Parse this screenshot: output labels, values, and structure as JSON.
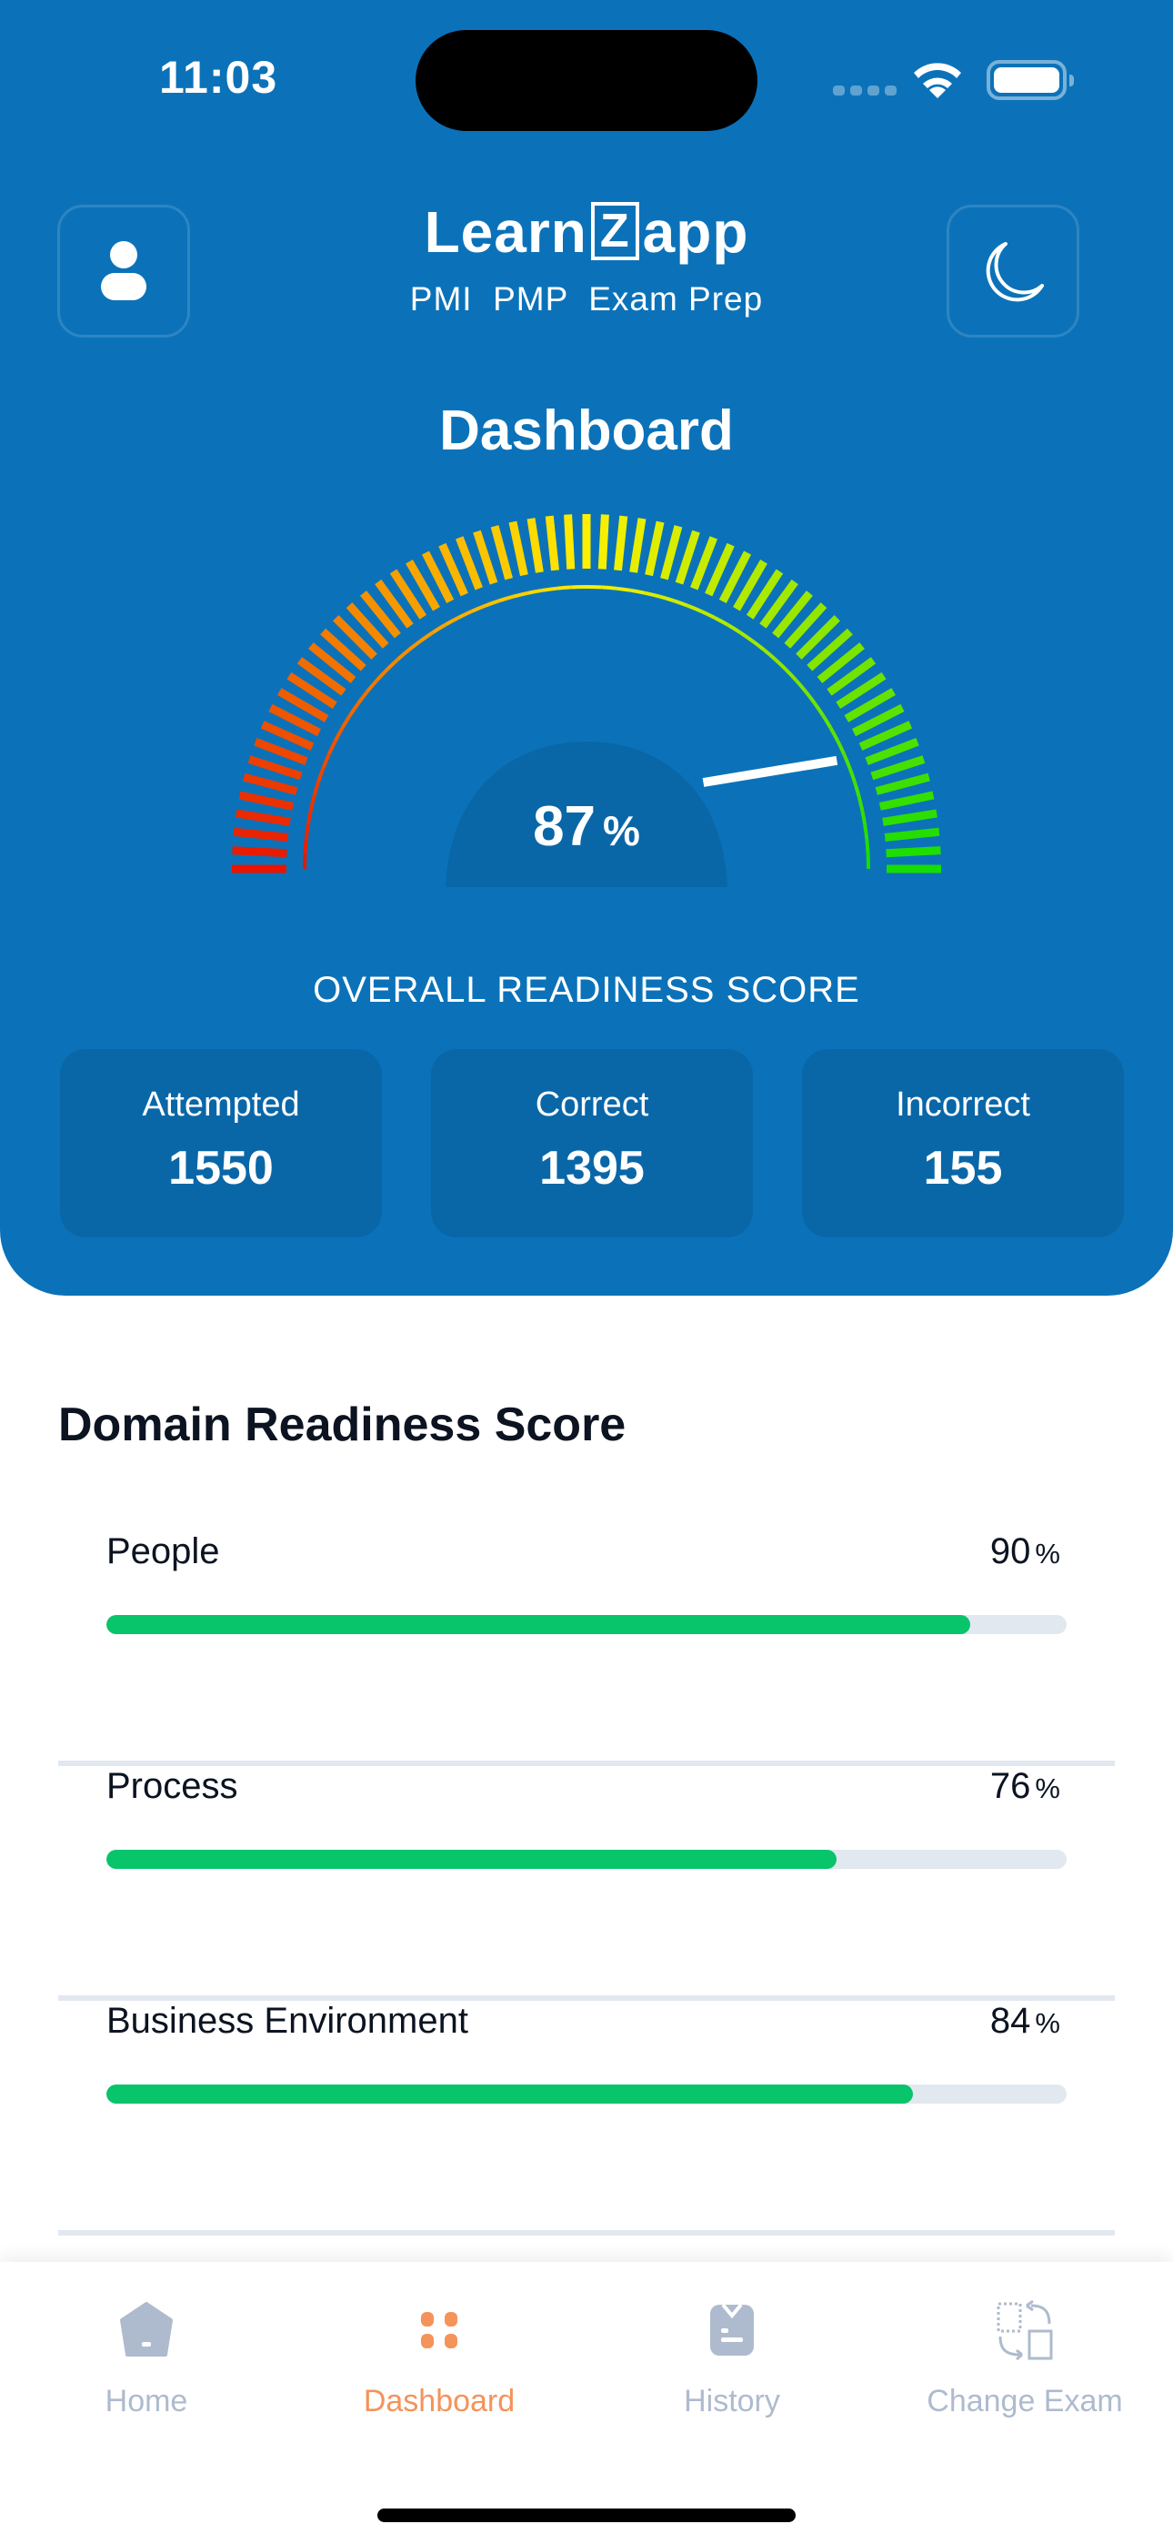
{
  "status_bar": {
    "time": "11:03"
  },
  "header": {
    "logo_left": "Learn",
    "logo_mid": "Z",
    "logo_right": "app",
    "subtitle": "PMI  PMP  Exam Prep",
    "title": "Dashboard",
    "profile_icon": "user-icon",
    "theme_icon": "moon-icon"
  },
  "gauge": {
    "value_percent": 87,
    "value_text": "87",
    "unit": "%",
    "label": "OVERALL READINESS SCORE",
    "colors": {
      "low": "#E81400",
      "mid": "#FFF000",
      "high": "#16DC00"
    }
  },
  "stats": [
    {
      "label": "Attempted",
      "value": "1550"
    },
    {
      "label": "Correct",
      "value": "1395"
    },
    {
      "label": "Incorrect",
      "value": "155"
    }
  ],
  "domains": {
    "title": "Domain Readiness Score",
    "items": [
      {
        "name": "People",
        "percent": 90,
        "percent_text": "90",
        "unit": "%"
      },
      {
        "name": "Process",
        "percent": 76,
        "percent_text": "76",
        "unit": "%"
      },
      {
        "name": "Business Environment",
        "percent": 84,
        "percent_text": "84",
        "unit": "%"
      }
    ]
  },
  "tabbar": {
    "active": "Dashboard",
    "accent": "#F4935A",
    "inactive": "#AEBBCE",
    "items": [
      {
        "label": "Home",
        "icon": "home-icon"
      },
      {
        "label": "Dashboard",
        "icon": "dashboard-grid-icon"
      },
      {
        "label": "History",
        "icon": "history-clipboard-icon"
      },
      {
        "label": "Change Exam",
        "icon": "swap-exam-icon"
      }
    ]
  }
}
